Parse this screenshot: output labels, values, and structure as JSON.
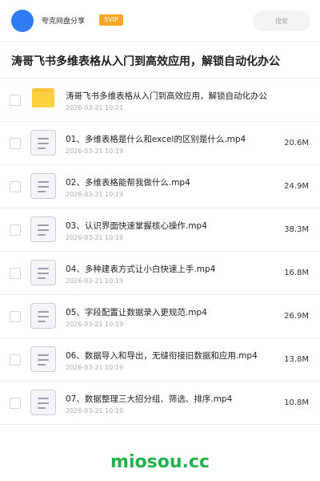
{
  "header": {
    "share_name": "夸克网盘分享",
    "badge": "SVIP",
    "search_placeholder": "搜索",
    "avatar_color": "#2f7cf6"
  },
  "title": {
    "text": "涛哥飞书多维表格从入门到高效应用，解锁自动化办公",
    "meta": "..."
  },
  "items": [
    {
      "type": "folder",
      "name": "涛哥飞书多维表格从入门到高效应用，解锁自动化办公",
      "date": "2026-03-21 10:21",
      "size": ""
    },
    {
      "type": "file",
      "name": "01、多维表格是什么和excel的区别是什么.mp4",
      "date": "2026-03-21 10:19",
      "size": "20.6M"
    },
    {
      "type": "file",
      "name": "02、多维表格能帮我做什么.mp4",
      "date": "2026-03-21 10:19",
      "size": "24.9M"
    },
    {
      "type": "file",
      "name": "03、认识界面快速掌握核心操作.mp4",
      "date": "2026-03-21 10:19",
      "size": "38.3M"
    },
    {
      "type": "file",
      "name": "04、多种建表方式让小白快速上手.mp4",
      "date": "2026-03-21 10:19",
      "size": "16.8M"
    },
    {
      "type": "file",
      "name": "05、字段配置让数据录入更规范.mp4",
      "date": "2026-03-21 10:19",
      "size": "26.9M"
    },
    {
      "type": "file",
      "name": "06、数据导入和导出，无缝衔接旧数据和应用.mp4",
      "date": "2026-03-21 10:19",
      "size": "13.8M"
    },
    {
      "type": "file",
      "name": "07、数据整理三大招分组、筛选、排序.mp4",
      "date": "2026-03-21 10:19",
      "size": "10.8M"
    }
  ],
  "footer": {
    "brand": "miosou.cc"
  },
  "colors": {
    "accent": "#2f7cf6",
    "badge": "#f6a623",
    "folder": "#fcd13f",
    "brand": "#21b04b"
  }
}
